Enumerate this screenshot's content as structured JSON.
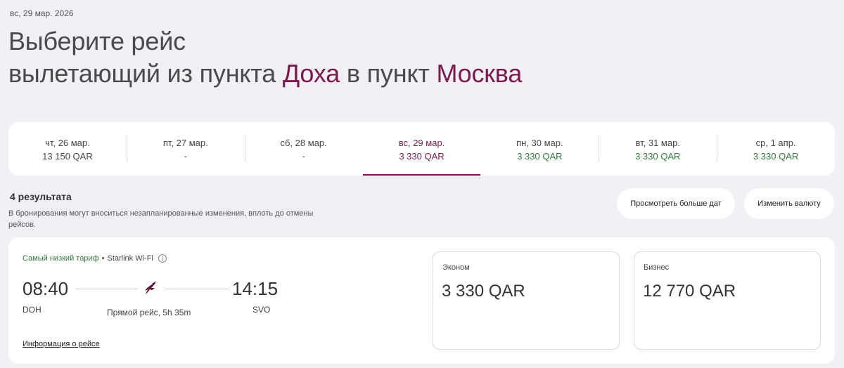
{
  "header": {
    "date": "вс, 29 мар. 2026",
    "title_line1": "Выберите рейс",
    "title_line2_prefix": "вылетающий из пункта ",
    "origin_city": "Доха",
    "title_line2_middle": " в пункт ",
    "destination_city": "Москва"
  },
  "date_strip": {
    "days": [
      {
        "label": "чт, 26 мар.",
        "price": "13 150 QAR"
      },
      {
        "label": "пт, 27 мар.",
        "price": "-"
      },
      {
        "label": "сб, 28 мар.",
        "price": "-"
      },
      {
        "label": "вс, 29 мар.",
        "price": "3 330 QAR",
        "selected": true
      },
      {
        "label": "пн, 30 мар.",
        "price": "3 330 QAR"
      },
      {
        "label": "вт, 31 мар.",
        "price": "3 330 QAR"
      },
      {
        "label": "ср, 1 апр.",
        "price": "3 330 QAR"
      }
    ]
  },
  "results": {
    "count_label": "4 результата",
    "notice": "В бронирования могут вноситься незапланированные изменения, вплоть до отмены рейсов.",
    "more_dates_button": "Просмотреть больше дат",
    "change_currency_button": "Изменить валюту"
  },
  "flight": {
    "tag_lowest": "Самый низкий тариф",
    "tag_separator": "•",
    "tag_wifi": "Starlink Wi-Fi",
    "departure_time": "08:40",
    "arrival_time": "14:15",
    "departure_code": "DOH",
    "arrival_code": "SVO",
    "direct_label": "Прямой рейс, 5h 35m",
    "info_link": "Информация о рейсе",
    "fares": {
      "economy": {
        "name": "Эконом",
        "price": "3 330 QAR"
      },
      "business": {
        "name": "Бизнес",
        "price": "12 770 QAR"
      }
    }
  },
  "colors": {
    "accent": "#7a1a4e",
    "green": "#2f7a3e",
    "background": "#f2eff5"
  }
}
